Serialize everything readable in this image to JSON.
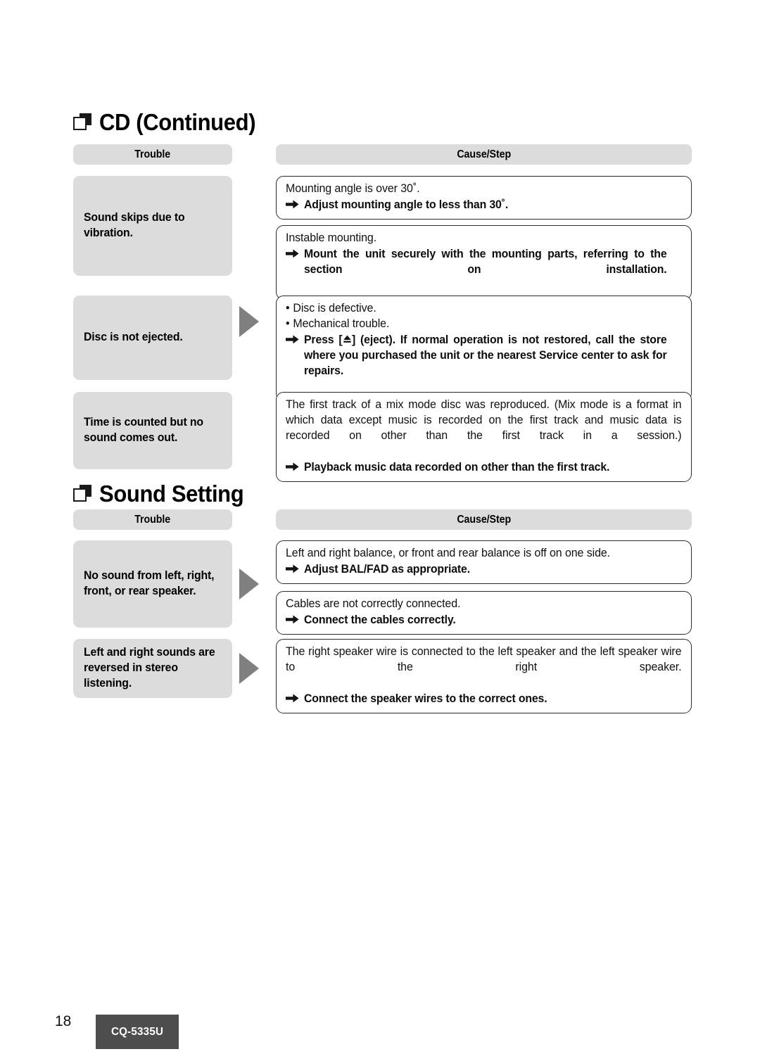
{
  "page": {
    "number": "18",
    "model": "CQ-5335U"
  },
  "columns": {
    "trouble_label": "Trouble",
    "cause_label": "Cause/Step"
  },
  "sections": [
    {
      "id": "cd-continued",
      "title": "CD (Continued)",
      "icon": "double-square-icon",
      "rows": [
        {
          "trouble": "Sound skips due to vibration.",
          "has_connector": false,
          "boxes": [
            {
              "cause": "Mounting angle is over 30˚.",
              "action": "Adjust mounting angle to less than 30˚."
            },
            {
              "cause": "Instable mounting.",
              "action": "Mount the unit securely with the mounting parts, referring to the section on installation."
            }
          ]
        },
        {
          "trouble": "Disc is not ejected.",
          "has_connector": true,
          "boxes": [
            {
              "bullets": [
                "Disc is defective.",
                "Mechanical trouble."
              ],
              "action_prefix": "Press [",
              "action_glyph": "eject-icon",
              "action_suffix": "] (eject). If normal operation is not restored, call the store where you purchased the unit or the nearest Service center to ask for repairs."
            }
          ]
        },
        {
          "trouble": "Time is counted but no sound comes out.",
          "has_connector": false,
          "boxes": [
            {
              "cause": "The first track of a mix mode disc was reproduced. (Mix mode is a format in which data except music is recorded on the first track and music data is recorded on other than the first track in a session.)",
              "action": "Playback music data recorded on other than the first track."
            }
          ]
        }
      ]
    },
    {
      "id": "sound-setting",
      "title": "Sound Setting",
      "icon": "double-square-icon",
      "rows": [
        {
          "trouble": "No sound from left, right, front, or rear speaker.",
          "has_connector": true,
          "boxes": [
            {
              "cause": "Left and right balance, or front and rear balance is off on one side.",
              "action": "Adjust BAL/FAD as appropriate."
            },
            {
              "cause": "Cables are not correctly connected.",
              "action": "Connect the cables correctly."
            }
          ]
        },
        {
          "trouble": "Left and right sounds are reversed in stereo listening.",
          "has_connector": true,
          "boxes": [
            {
              "cause": "The right speaker wire is connected to the left speaker and the left speaker wire to the right speaker.",
              "action": "Connect the speaker wires to the correct ones."
            }
          ]
        }
      ]
    }
  ],
  "colors": {
    "cell_gray": "#dcdcdc",
    "connector_gray": "#808080",
    "box_border": "#2b2b2b",
    "footer_box": "#4d4d4d"
  }
}
